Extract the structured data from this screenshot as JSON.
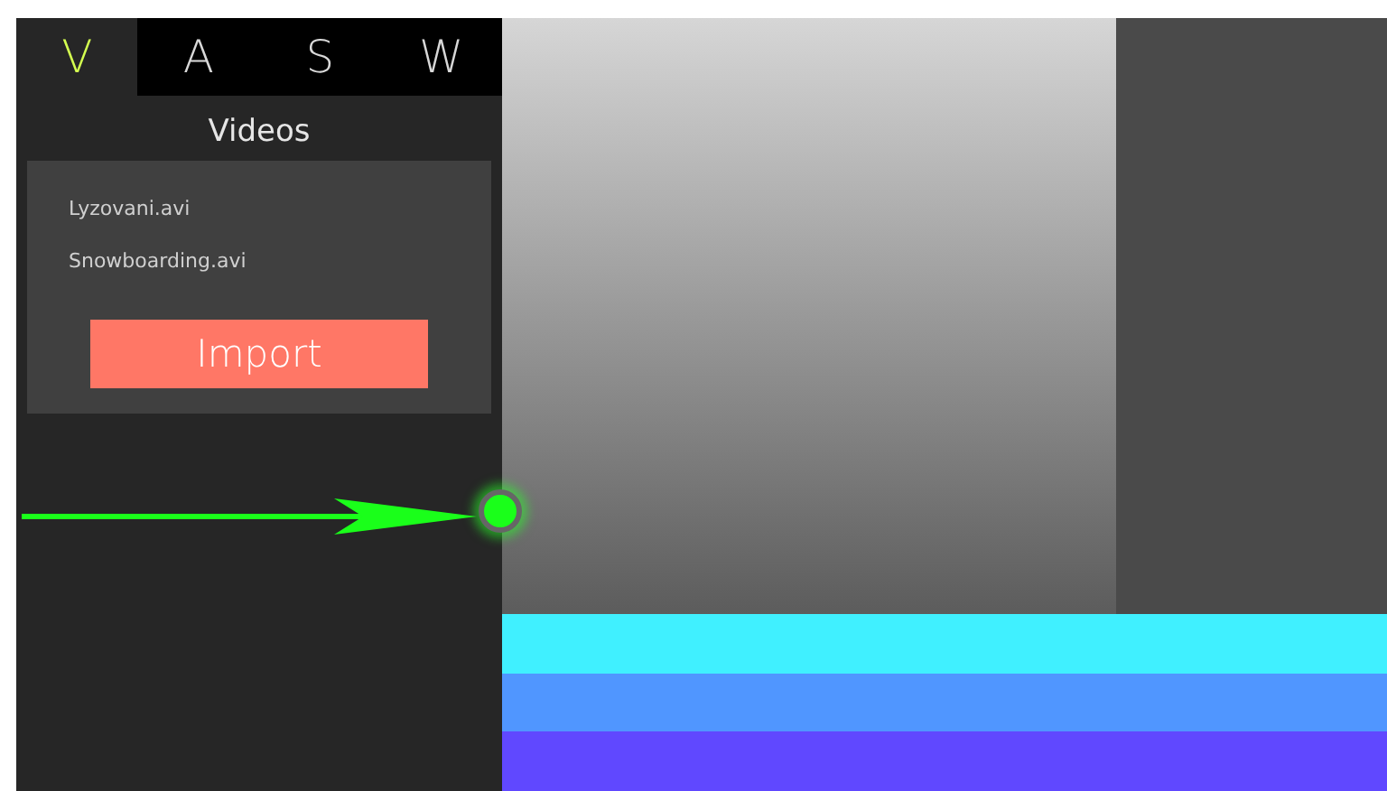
{
  "tabs": [
    {
      "label": "V",
      "selected": true
    },
    {
      "label": "A",
      "selected": false
    },
    {
      "label": "S",
      "selected": false
    },
    {
      "label": "W",
      "selected": false
    }
  ],
  "panel": {
    "title": "Videos",
    "files": [
      "Lyzovani.avi",
      "Snowboarding.avi"
    ],
    "button": "Import"
  },
  "bands": [
    {
      "color": "#40f0ff"
    },
    {
      "color": "#5096ff"
    },
    {
      "color": "#6048ff"
    }
  ]
}
